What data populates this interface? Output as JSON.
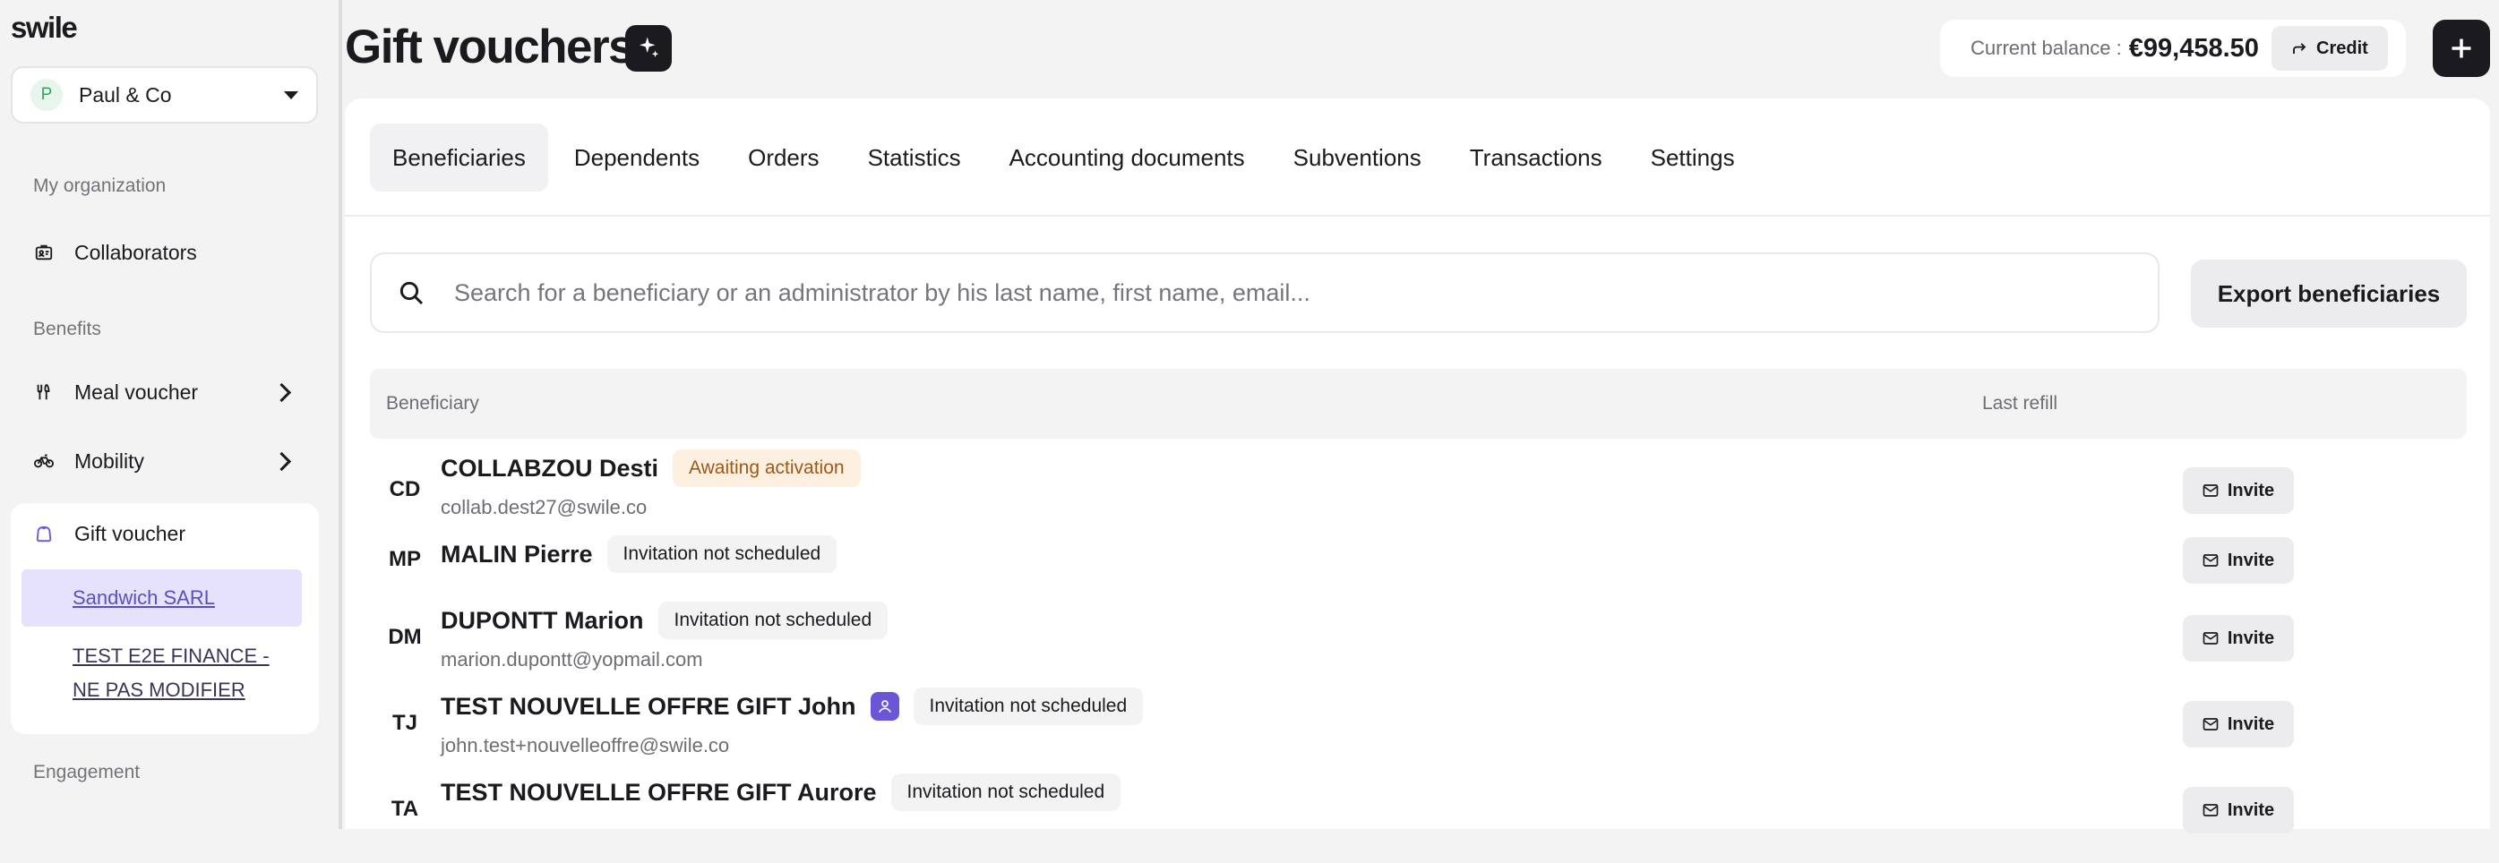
{
  "app": {
    "logo": "swile"
  },
  "sidebar": {
    "org": {
      "initial": "P",
      "name": "Paul & Co"
    },
    "sections": {
      "my_org": "My organization",
      "benefits": "Benefits",
      "engagement": "Engagement"
    },
    "items": {
      "collaborators": "Collaborators",
      "meal_voucher": "Meal voucher",
      "mobility": "Mobility",
      "gift_voucher": "Gift voucher"
    },
    "gift_sub": {
      "sandwich": "Sandwich SARL",
      "test_e2e": "TEST E2E FINANCE - NE PAS MODIFIER"
    }
  },
  "header": {
    "title": "Gift vouchers",
    "balance_label": "Current balance :",
    "balance_value": "€99,458.50",
    "credit_label": "Credit"
  },
  "tabs": [
    "Beneficiaries",
    "Dependents",
    "Orders",
    "Statistics",
    "Accounting documents",
    "Subventions",
    "Transactions",
    "Settings"
  ],
  "search": {
    "placeholder": "Search for a beneficiary or an administrator by his last name, first name, email..."
  },
  "export_label": "Export beneficiaries",
  "table": {
    "headers": {
      "beneficiary": "Beneficiary",
      "last_refill": "Last refill"
    },
    "invite_label": "Invite",
    "rows": [
      {
        "initials": "CD",
        "name": "COLLABZOU Desti",
        "status": "Awaiting activation",
        "email": "collab.dest27@swile.co"
      },
      {
        "initials": "MP",
        "name": "MALIN Pierre",
        "status": "Invitation not scheduled",
        "email": ""
      },
      {
        "initials": "DM",
        "name": "DUPONTT Marion",
        "status": "Invitation not scheduled",
        "email": "marion.dupontt@yopmail.com"
      },
      {
        "initials": "TJ",
        "name": "TEST NOUVELLE OFFRE GIFT John",
        "status": "Invitation not scheduled",
        "email": "john.test+nouvelleoffre@swile.co"
      },
      {
        "initials": "TA",
        "name": "TEST NOUVELLE OFFRE GIFT Aurore",
        "status": "Invitation not scheduled",
        "email": ""
      }
    ]
  },
  "colors": {
    "accent": "#6b56d8",
    "dark": "#1b1b1f",
    "awaiting_bg": "#fdf0e0",
    "awaiting_text": "#9a5a1a"
  }
}
